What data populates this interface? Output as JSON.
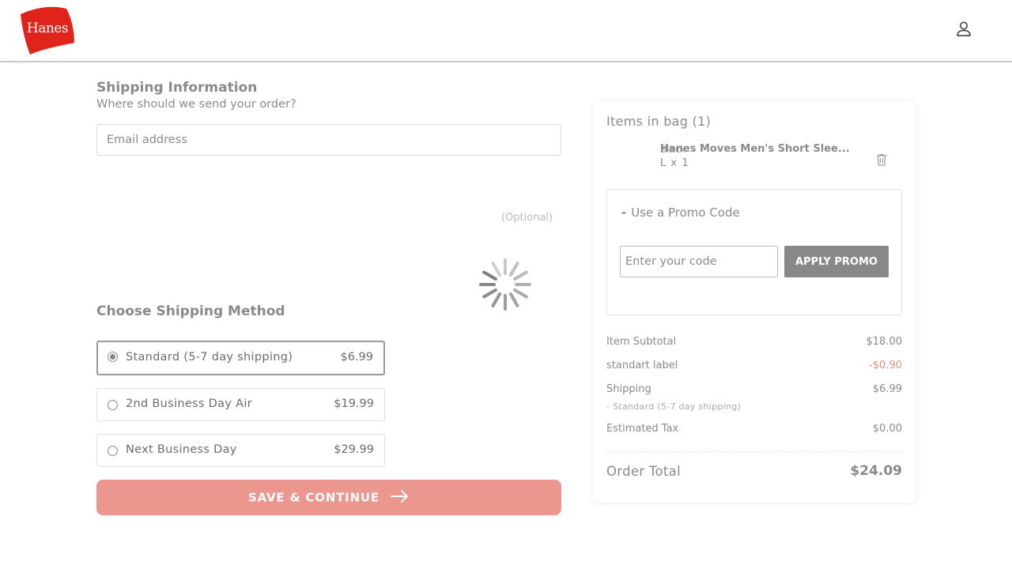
{
  "header": {
    "logo_text": "Hanes"
  },
  "shipping_info": {
    "title": "Shipping Information",
    "subtitle": "Where should we send your order?",
    "email_placeholder": "Email address",
    "optional_label": "(Optional)"
  },
  "shipping_method": {
    "title": "Choose Shipping Method",
    "options": [
      {
        "label": "Standard (5-7 day shipping)",
        "price": "$6.99",
        "selected": true
      },
      {
        "label": "2nd Business Day Air",
        "price": "$19.99",
        "selected": false
      },
      {
        "label": "Next Business Day",
        "price": "$29.99",
        "selected": false
      }
    ]
  },
  "save_button": {
    "label": "SAVE & CONTINUE"
  },
  "bag": {
    "title": "Items in bag (1)",
    "item": {
      "name": "Hanes Moves Men's Short Slee...",
      "color": "Black",
      "size_qty": "L  x 1"
    }
  },
  "promo": {
    "toggle_label": "Use a Promo Code",
    "input_placeholder": "Enter your code",
    "apply_label": "APPLY PROMO"
  },
  "summary": {
    "subtotal_label": "Item Subtotal",
    "subtotal_value": "$18.00",
    "discount_label": "standart label",
    "discount_value": "-$0.90",
    "shipping_label": "Shipping",
    "shipping_value": "$6.99",
    "shipping_method": "- Standard (5-7 day shipping)",
    "tax_label": "Estimated Tax",
    "tax_value": "$0.00",
    "total_label": "Order Total",
    "total_value": "$24.09"
  },
  "colors": {
    "brand_red": "#e0241b",
    "save_button": "#ec9690",
    "discount": "#e88a82"
  }
}
